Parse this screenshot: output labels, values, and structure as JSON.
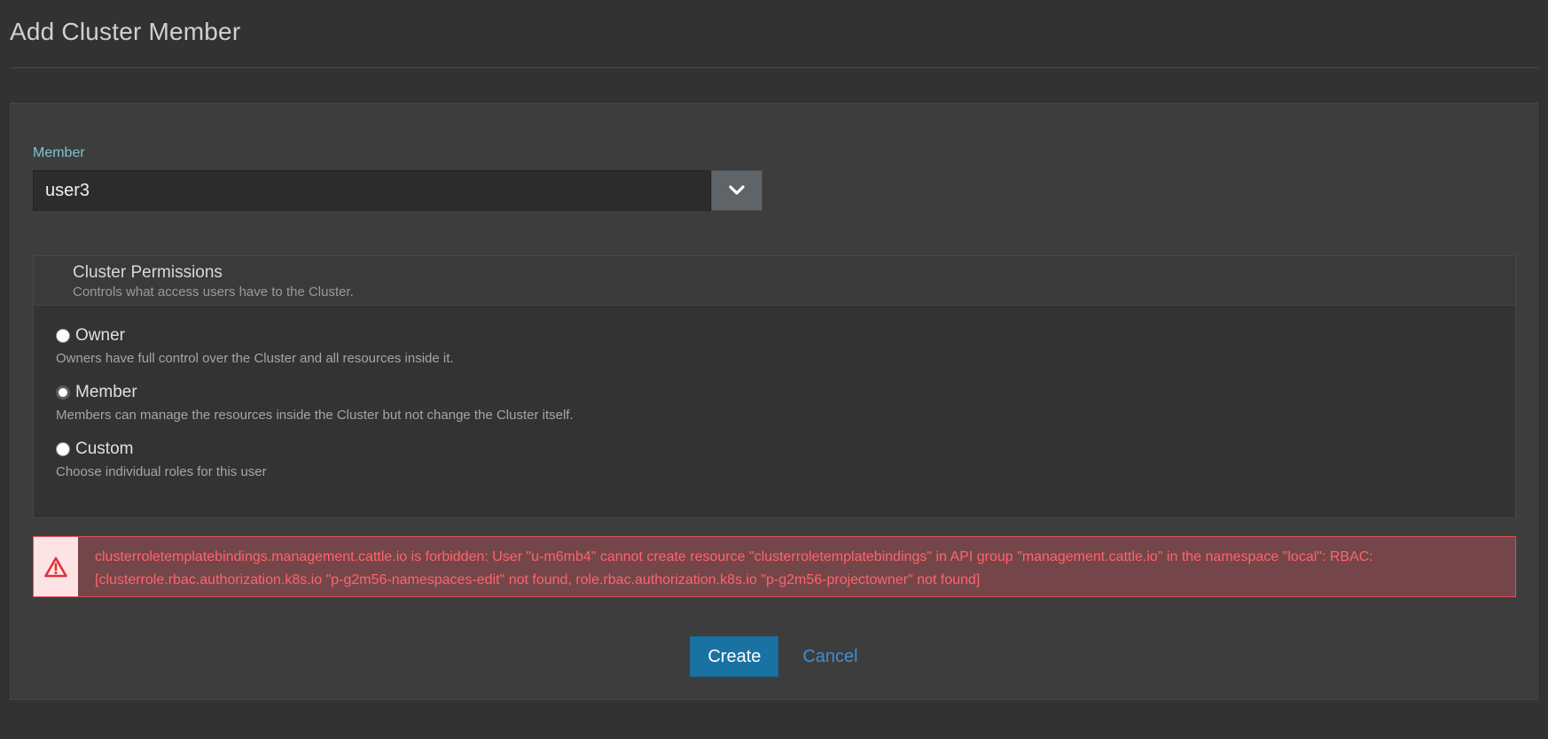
{
  "header": {
    "title": "Add Cluster Member"
  },
  "member": {
    "label": "Member",
    "value": "user3"
  },
  "permissions": {
    "title": "Cluster Permissions",
    "subtitle": "Controls what access users have to the Cluster.",
    "options": [
      {
        "label": "Owner",
        "description": "Owners have full control over the Cluster and all resources inside it."
      },
      {
        "label": "Member",
        "description": "Members can manage the resources inside the Cluster but not change the Cluster itself."
      },
      {
        "label": "Custom",
        "description": "Choose individual roles for this user"
      }
    ]
  },
  "error": {
    "message": "clusterroletemplatebindings.management.cattle.io is forbidden: User \"u-m6mb4\" cannot create resource \"clusterroletemplatebindings\" in API group \"management.cattle.io\" in the namespace \"local\": RBAC: [clusterrole.rbac.authorization.k8s.io \"p-g2m56-namespaces-edit\" not found, role.rbac.authorization.k8s.io \"p-g2m56-projectowner\" not found]"
  },
  "actions": {
    "create_label": "Create",
    "cancel_label": "Cancel"
  },
  "icons": {
    "dropdown": "chevron-down-icon",
    "error": "warning-triangle-icon"
  },
  "colors": {
    "accent": "#1a72a3",
    "label": "#7ec3cf",
    "error": "#ff646c",
    "link": "#3b8ed6"
  }
}
